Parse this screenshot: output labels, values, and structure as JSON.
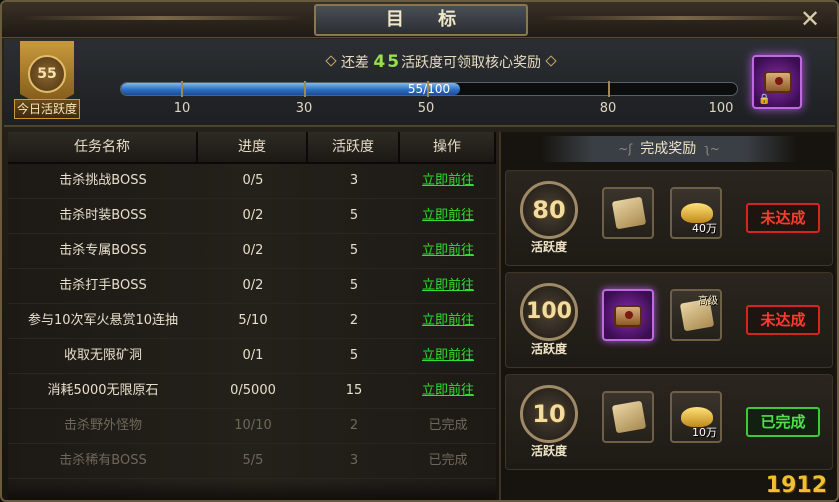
{
  "window": {
    "title": "目 标",
    "close_icon": "close-icon"
  },
  "daily": {
    "badge_value": "55",
    "badge_label": "今日活跃度",
    "tip_prefix": "还差",
    "tip_number": "45",
    "tip_suffix": "活跃度可领取核心奖励",
    "progress_text": "55/100",
    "progress_value": 55,
    "progress_max": 100,
    "ticks": [
      "10",
      "30",
      "50",
      "80",
      "100"
    ],
    "core_reward_icon": "scroll-chest-icon"
  },
  "table": {
    "headers": [
      "任务名称",
      "进度",
      "活跃度",
      "操作"
    ],
    "rows": [
      {
        "name": "击杀挑战BOSS",
        "progress": "0/5",
        "points": "3",
        "action": "立即前往",
        "done": false
      },
      {
        "name": "击杀时装BOSS",
        "progress": "0/2",
        "points": "5",
        "action": "立即前往",
        "done": false
      },
      {
        "name": "击杀专属BOSS",
        "progress": "0/2",
        "points": "5",
        "action": "立即前往",
        "done": false
      },
      {
        "name": "击杀打手BOSS",
        "progress": "0/2",
        "points": "5",
        "action": "立即前往",
        "done": false
      },
      {
        "name": "参与10次军火悬赏10连抽",
        "progress": "5/10",
        "points": "2",
        "action": "立即前往",
        "done": false
      },
      {
        "name": "收取无限矿洞",
        "progress": "0/1",
        "points": "5",
        "action": "立即前往",
        "done": false
      },
      {
        "name": "消耗5000无限原石",
        "progress": "0/5000",
        "points": "15",
        "action": "立即前往",
        "done": false
      },
      {
        "name": "击杀野外怪物",
        "progress": "10/10",
        "points": "2",
        "action": "已完成",
        "done": true
      },
      {
        "name": "击杀稀有BOSS",
        "progress": "5/5",
        "points": "3",
        "action": "已完成",
        "done": true
      },
      {
        "name": "",
        "progress": "",
        "points": "",
        "action": "",
        "done": true
      }
    ]
  },
  "rewards": {
    "header": "完成奖励",
    "tiers": [
      {
        "points": "80",
        "label": "活跃度",
        "items": [
          {
            "icon": "map-scroll-icon",
            "qty": ""
          },
          {
            "icon": "gold-ingot-icon",
            "qty": "40万"
          }
        ],
        "status": "未达成",
        "achieved": false
      },
      {
        "points": "100",
        "label": "活跃度",
        "items": [
          {
            "icon": "scroll-chest-icon",
            "qty": ""
          },
          {
            "icon": "map-scroll-icon",
            "qty": "",
            "tag": "高级"
          }
        ],
        "status": "未达成",
        "achieved": false
      },
      {
        "points": "10",
        "label": "活跃度",
        "items": [
          {
            "icon": "map-scroll-icon",
            "qty": ""
          },
          {
            "icon": "gold-ingot-icon",
            "qty": "10万"
          }
        ],
        "status": "已完成",
        "achieved": true
      }
    ]
  },
  "watermark": "1912"
}
